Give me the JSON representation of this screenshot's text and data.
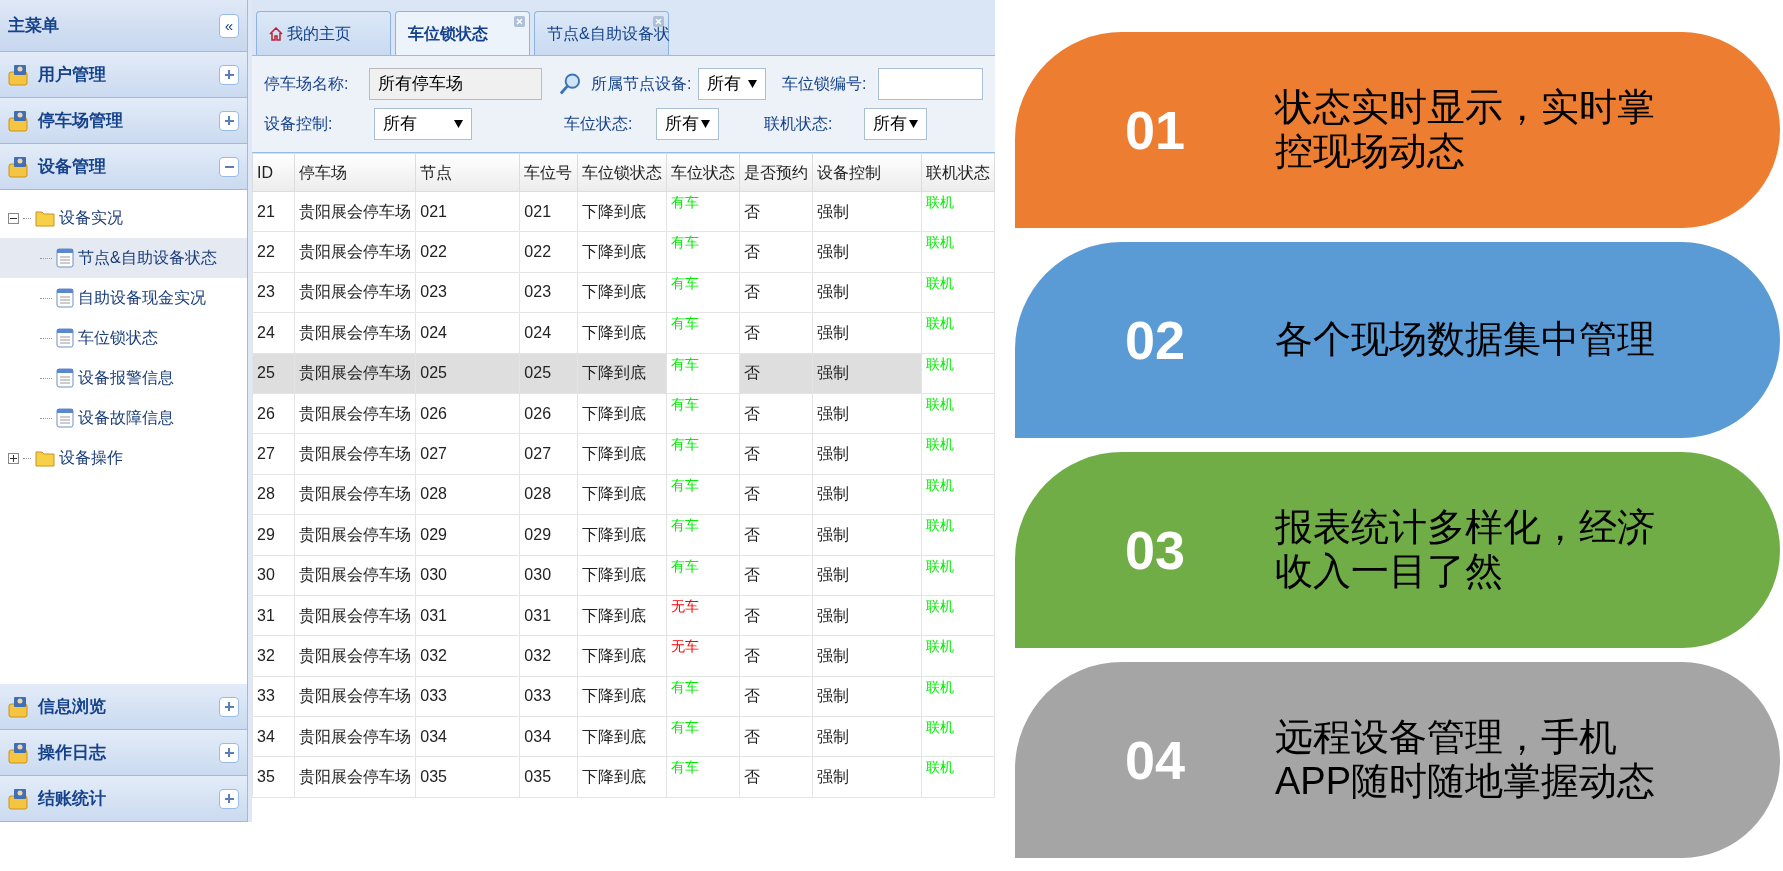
{
  "sidebar": {
    "title": "主菜单",
    "collapse_label": "«",
    "sections_top": [
      {
        "label": "用户管理",
        "expanded": false
      },
      {
        "label": "停车场管理",
        "expanded": false
      },
      {
        "label": "设备管理",
        "expanded": true
      }
    ],
    "tree": [
      {
        "label": "设备实况",
        "expanded": true,
        "children": [
          {
            "label": "节点&自助设备状态",
            "selected": true
          },
          {
            "label": "自助设备现金实况",
            "selected": false
          },
          {
            "label": "车位锁状态",
            "selected": false
          },
          {
            "label": "设备报警信息",
            "selected": false
          },
          {
            "label": "设备故障信息",
            "selected": false
          }
        ]
      },
      {
        "label": "设备操作",
        "expanded": false
      }
    ],
    "sections_bottom": [
      {
        "label": "信息浏览",
        "expanded": false
      },
      {
        "label": "操作日志",
        "expanded": false
      },
      {
        "label": "结账统计",
        "expanded": false
      }
    ]
  },
  "tabs": [
    {
      "label": "我的主页",
      "selected": false,
      "kind": "home"
    },
    {
      "label": "车位锁状态",
      "selected": true,
      "kind": "closable"
    },
    {
      "label": "节点&自助设备状",
      "selected": false,
      "kind": "closable"
    }
  ],
  "filters": {
    "park_name": {
      "label": "停车场名称:",
      "value": "所有停车场"
    },
    "node": {
      "label": "所属节点设备:",
      "value": "所有"
    },
    "lock_no": {
      "label": "车位锁编号:"
    },
    "control": {
      "label": "设备控制:",
      "value": "所有"
    },
    "space_state": {
      "label": "车位状态:",
      "value": "所有"
    },
    "online": {
      "label": "联机状态:",
      "value": "所有"
    }
  },
  "table": {
    "columns": [
      "ID",
      "停车场",
      "节点",
      "车位号",
      "车位锁状态",
      "车位状态",
      "是否预约",
      "设备控制",
      "联机状态"
    ],
    "rows": [
      {
        "selected": false,
        "cells": [
          "21",
          "贵阳展会停车场",
          "021",
          "021",
          "下降到底",
          {
            "text": "有车",
            "color": "#00ee00"
          },
          "否",
          "强制",
          {
            "text": "联机",
            "color": "#00ee00"
          }
        ]
      },
      {
        "selected": false,
        "cells": [
          "22",
          "贵阳展会停车场",
          "022",
          "022",
          "下降到底",
          {
            "text": "有车",
            "color": "#00ee00"
          },
          "否",
          "强制",
          {
            "text": "联机",
            "color": "#00ee00"
          }
        ]
      },
      {
        "selected": false,
        "cells": [
          "23",
          "贵阳展会停车场",
          "023",
          "023",
          "下降到底",
          {
            "text": "有车",
            "color": "#00ee00"
          },
          "否",
          "强制",
          {
            "text": "联机",
            "color": "#00ee00"
          }
        ]
      },
      {
        "selected": false,
        "cells": [
          "24",
          "贵阳展会停车场",
          "024",
          "024",
          "下降到底",
          {
            "text": "有车",
            "color": "#00ee00"
          },
          "否",
          "强制",
          {
            "text": "联机",
            "color": "#00ee00"
          }
        ]
      },
      {
        "selected": true,
        "cells": [
          "25",
          "贵阳展会停车场",
          "025",
          "025",
          "下降到底",
          {
            "text": "有车",
            "color": "#00ee00"
          },
          "否",
          "强制",
          {
            "text": "联机",
            "color": "#00ee00"
          }
        ]
      },
      {
        "selected": false,
        "cells": [
          "26",
          "贵阳展会停车场",
          "026",
          "026",
          "下降到底",
          {
            "text": "有车",
            "color": "#00ee00"
          },
          "否",
          "强制",
          {
            "text": "联机",
            "color": "#00ee00"
          }
        ]
      },
      {
        "selected": false,
        "cells": [
          "27",
          "贵阳展会停车场",
          "027",
          "027",
          "下降到底",
          {
            "text": "有车",
            "color": "#00ee00"
          },
          "否",
          "强制",
          {
            "text": "联机",
            "color": "#00ee00"
          }
        ]
      },
      {
        "selected": false,
        "cells": [
          "28",
          "贵阳展会停车场",
          "028",
          "028",
          "下降到底",
          {
            "text": "有车",
            "color": "#00ee00"
          },
          "否",
          "强制",
          {
            "text": "联机",
            "color": "#00ee00"
          }
        ]
      },
      {
        "selected": false,
        "cells": [
          "29",
          "贵阳展会停车场",
          "029",
          "029",
          "下降到底",
          {
            "text": "有车",
            "color": "#00ee00"
          },
          "否",
          "强制",
          {
            "text": "联机",
            "color": "#00ee00"
          }
        ]
      },
      {
        "selected": false,
        "cells": [
          "30",
          "贵阳展会停车场",
          "030",
          "030",
          "下降到底",
          {
            "text": "有车",
            "color": "#00ee00"
          },
          "否",
          "强制",
          {
            "text": "联机",
            "color": "#00ee00"
          }
        ]
      },
      {
        "selected": false,
        "cells": [
          "31",
          "贵阳展会停车场",
          "031",
          "031",
          "下降到底",
          {
            "text": "无车",
            "color": "#ff0000"
          },
          "否",
          "强制",
          {
            "text": "联机",
            "color": "#00ee00"
          }
        ]
      },
      {
        "selected": false,
        "cells": [
          "32",
          "贵阳展会停车场",
          "032",
          "032",
          "下降到底",
          {
            "text": "无车",
            "color": "#ff0000"
          },
          "否",
          "强制",
          {
            "text": "联机",
            "color": "#00ee00"
          }
        ]
      },
      {
        "selected": false,
        "cells": [
          "33",
          "贵阳展会停车场",
          "033",
          "033",
          "下降到底",
          {
            "text": "有车",
            "color": "#00ee00"
          },
          "否",
          "强制",
          {
            "text": "联机",
            "color": "#00ee00"
          }
        ]
      },
      {
        "selected": false,
        "cells": [
          "34",
          "贵阳展会停车场",
          "034",
          "034",
          "下降到底",
          {
            "text": "有车",
            "color": "#00ee00"
          },
          "否",
          "强制",
          {
            "text": "联机",
            "color": "#00ee00"
          }
        ]
      },
      {
        "selected": false,
        "cells": [
          "35",
          "贵阳展会停车场",
          "035",
          "035",
          "下降到底",
          {
            "text": "有车",
            "color": "#00ee00"
          },
          "否",
          "强制",
          {
            "text": "联机",
            "color": "#00ee00"
          }
        ]
      }
    ]
  },
  "features": [
    {
      "number": "01",
      "text": "状态实时显示，实时掌控现场动态",
      "color": "#ed7d31"
    },
    {
      "number": "02",
      "text": "各个现场数据集中管理",
      "color": "#5b9bd5"
    },
    {
      "number": "03",
      "text": "报表统计多样化，经济收入一目了然",
      "color": "#70ad47"
    },
    {
      "number": "04",
      "text": "远程设备管理，手机APP随时随地掌握动态",
      "color": "#a5a5a5"
    }
  ]
}
